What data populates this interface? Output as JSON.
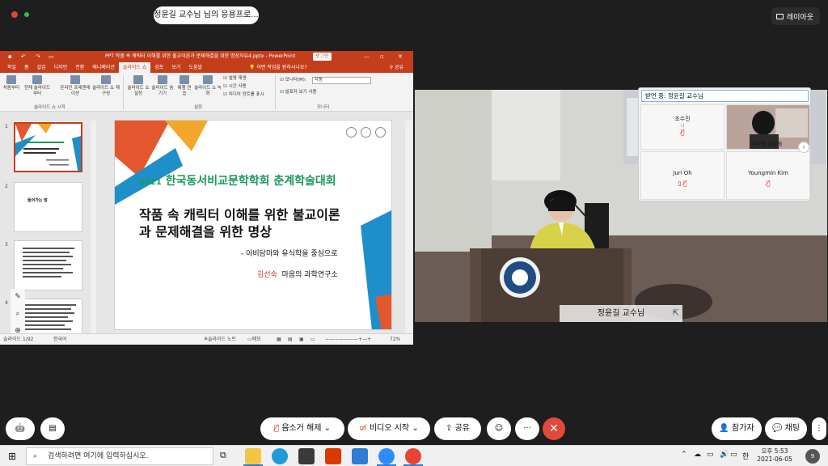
{
  "meeting": {
    "share_title": "정윤길 교수님 님의 응용프로...",
    "layout_label": "레이아웃",
    "speaker_name": "정윤길 교수님",
    "receiving_label": "받언 중: 정윤길 교수님",
    "participants": [
      {
        "name": "조수진",
        "sub": "나",
        "mic": "muted"
      },
      {
        "name": "이석광 김상태",
        "sub": "",
        "mic": "video"
      },
      {
        "name": "Juri Oh",
        "sub": "",
        "mic": "muted"
      },
      {
        "name": "Youngmin Kim",
        "sub": "",
        "mic": "muted"
      }
    ]
  },
  "ppt": {
    "doc_title": "PPT 작품 속 캐릭터 이해를 위한 불교이론과 문제해결을 위한 명상자유4.pptx  -  PowerPoint",
    "login_label": "로그인",
    "tabs": [
      "파일",
      "홈",
      "삽입",
      "디자인",
      "전환",
      "애니메이션",
      "슬라이드 쇼",
      "검토",
      "보기",
      "도움말"
    ],
    "tell_me": "어떤 작업을 원하시나요?",
    "share_label": "공유",
    "ribbon": {
      "from_start": "처음부터",
      "from_current": "현재 슬라이드부터",
      "online_present": "온라인 프레젠테이션",
      "custom_show": "슬라이드 쇼 재구성",
      "group_start": "슬라이드 쇼 시작",
      "setup_show": "슬라이드 쇼 설정",
      "hide_slide": "슬라이드 숨기기",
      "rehearse": "예행 연습",
      "record": "슬라이드 쇼 녹화",
      "group_setup": "설정",
      "chk_narration": "설명 재생",
      "chk_timings": "시간 사용",
      "chk_media": "미디어 컨트롤 표시",
      "monitor_label": "모니터(M):",
      "monitor_value": "자동",
      "presenter_view": "발표자 보기 사용",
      "group_monitors": "모니터"
    },
    "thumbnails": [
      "1",
      "2",
      "3",
      "4"
    ],
    "thumb2_text": "들어가는 말",
    "slide": {
      "year": "2021",
      "conference": "한국동서비교문학학회 춘계학술대회",
      "title": "작품 속 캐릭터 이해를 위한 불교이론\n과 문제해결을 위한 명상",
      "subtitle": "- 아비담마와 유식학을 중심으로",
      "author_name": "김선숙",
      "author_org": "마음의 과학연구소"
    },
    "status": {
      "slide_count": "슬라이드 1/92",
      "language": "한국어",
      "notes": "슬라이드 노트",
      "comments": "메모",
      "zoom": "72%"
    }
  },
  "controls": {
    "unmute": "음소거 해제",
    "start_video": "비디오 시작",
    "share": "공유",
    "participants": "참가자",
    "chat": "채팅"
  },
  "taskbar": {
    "search_placeholder": "검색하려면 여기에 입력하십시오.",
    "ime": "한",
    "time": "오후 5:53",
    "date": "2021-06-05",
    "notif_count": "9"
  }
}
